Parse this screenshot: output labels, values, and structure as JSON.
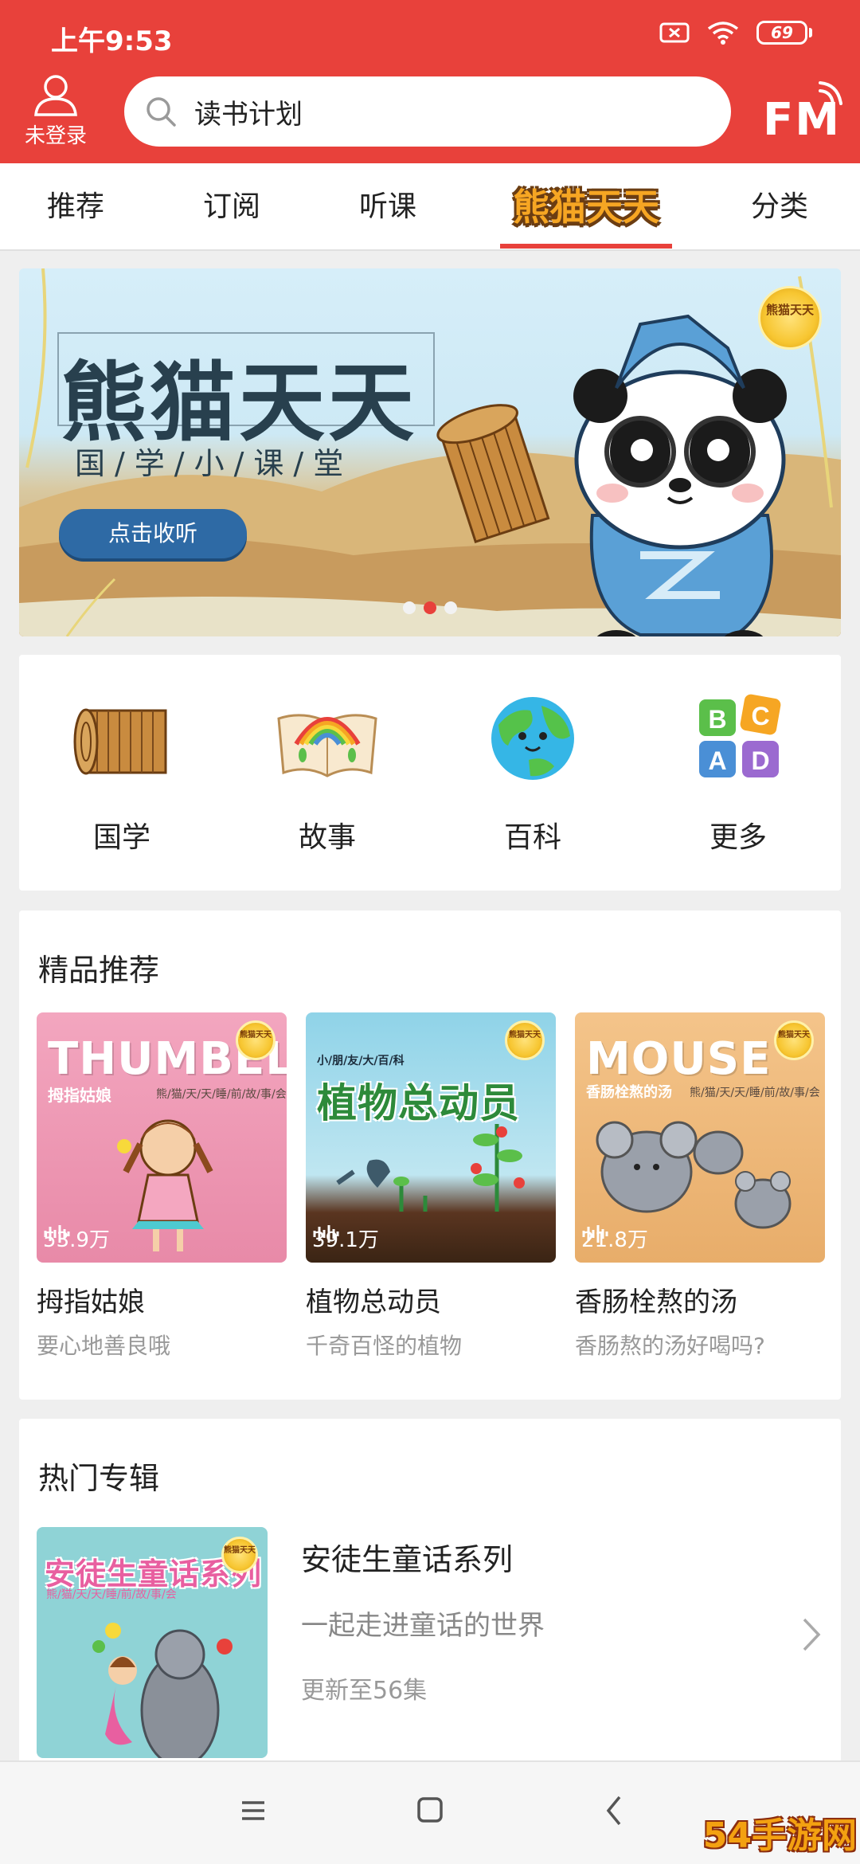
{
  "status": {
    "time": "上午9:53",
    "battery": "69"
  },
  "header": {
    "login_label": "未登录",
    "search_text": "读书计划",
    "fm_label": "FM"
  },
  "tabs": [
    {
      "label": "推荐"
    },
    {
      "label": "订阅"
    },
    {
      "label": "听课"
    },
    {
      "label": "熊猫天天"
    },
    {
      "label": "分类"
    }
  ],
  "banner": {
    "title": "熊猫天天",
    "subtitle": "国/学/小/课/堂",
    "button_label": "点击收听",
    "badge_text": "熊猫天天",
    "page_count": 3,
    "active_page": 2
  },
  "categories": [
    {
      "label": "国学",
      "icon": "bamboo-scroll-icon"
    },
    {
      "label": "故事",
      "icon": "rainbow-book-icon"
    },
    {
      "label": "百科",
      "icon": "earth-icon"
    },
    {
      "label": "更多",
      "icon": "abcd-blocks-icon"
    }
  ],
  "recommend": {
    "title": "精品推荐",
    "items": [
      {
        "cover_title": "THUMBELINA",
        "cover_sub": "拇指姑娘",
        "cover_sub_small": "熊/猫/天/天/睡/前/故/事/会",
        "plays": "53.9万",
        "name": "拇指姑娘",
        "desc": "要心地善良哦"
      },
      {
        "cover_title": "植物总动员",
        "cover_sub": "小/朋/友/大/百/科",
        "cover_sub_small": "",
        "plays": "39.1万",
        "name": "植物总动员",
        "desc": "千奇百怪的植物"
      },
      {
        "cover_title": "MOUSE",
        "cover_sub": "香肠栓熬的汤",
        "cover_sub_small": "熊/猫/天/天/睡/前/故/事/会",
        "plays": "21.8万",
        "name": "香肠栓熬的汤",
        "desc": "香肠熬的汤好喝吗?"
      }
    ]
  },
  "hot": {
    "title": "热门专辑",
    "album": {
      "cover_title": "安徒生童话系列",
      "cover_sub": "熊/猫/天/天/睡/前/故/事/会",
      "title": "安徒生童话系列",
      "desc": "一起走进童话的世界",
      "update": "更新至56集"
    }
  },
  "watermark": "54手游网",
  "colors": {
    "brand_red": "#e8413b",
    "text_dark": "#222222",
    "text_gray": "#999999"
  }
}
